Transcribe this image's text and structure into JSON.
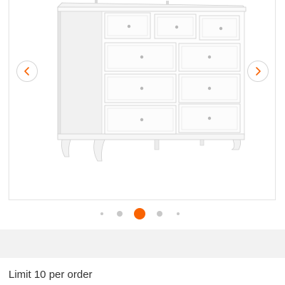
{
  "gallery": {
    "image_alt_icon": "dresser-image",
    "prev_icon": "chevron-left-icon",
    "next_icon": "chevron-right-icon",
    "dot_count": 5,
    "active_dot": 3,
    "active_color": "#f96302",
    "inactive_color": "#c8c8c8",
    "arrow_color": "#f96302"
  },
  "order": {
    "limit_text": "Limit 10 per order"
  }
}
